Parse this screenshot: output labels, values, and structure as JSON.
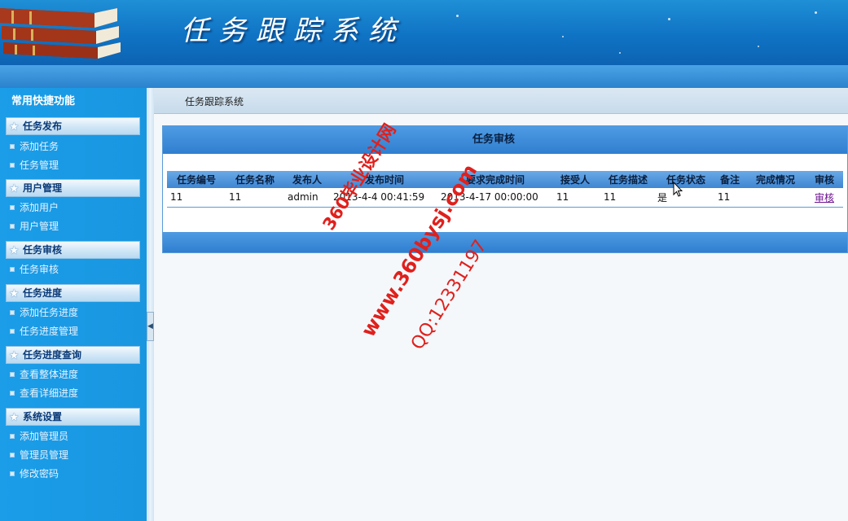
{
  "header": {
    "title": "任务跟踪系统"
  },
  "sidebar": {
    "title": "常用快捷功能",
    "groups": [
      {
        "label": "任务发布",
        "items": [
          {
            "label": "添加任务"
          },
          {
            "label": "任务管理"
          }
        ]
      },
      {
        "label": "用户管理",
        "items": [
          {
            "label": "添加用户"
          },
          {
            "label": "用户管理"
          }
        ]
      },
      {
        "label": "任务审核",
        "items": [
          {
            "label": "任务审核"
          }
        ]
      },
      {
        "label": "任务进度",
        "items": [
          {
            "label": "添加任务进度"
          },
          {
            "label": "任务进度管理"
          }
        ]
      },
      {
        "label": "任务进度查询",
        "items": [
          {
            "label": "查看整体进度"
          },
          {
            "label": "查看详细进度"
          }
        ]
      },
      {
        "label": "系统设置",
        "items": [
          {
            "label": "添加管理员"
          },
          {
            "label": "管理员管理"
          },
          {
            "label": "修改密码"
          }
        ]
      }
    ]
  },
  "breadcrumb": "任务跟踪系统",
  "panel": {
    "title": "任务审核",
    "columns": [
      "任务编号",
      "任务名称",
      "发布人",
      "发布时间",
      "要求完成时间",
      "接受人",
      "任务描述",
      "任务状态",
      "备注",
      "完成情况",
      "审核"
    ],
    "rows": [
      [
        "11",
        "11",
        "admin",
        "2013-4-4 00:41:59",
        "2013-4-17 00:00:00",
        "11",
        "11",
        "是",
        "11",
        "",
        "审核"
      ]
    ]
  },
  "watermark": {
    "line1": "360毕业设计网",
    "line2": "www.360bysj.com",
    "line3": "QQ:12331197"
  },
  "colors": {
    "header": "#0f73c4",
    "sidebar": "#1996e0",
    "panel_header": "#3f86d3",
    "link": "#6b0f8f",
    "watermark": "#e0201c"
  },
  "icons": {
    "logo": "books-icon",
    "group": "star-icon",
    "item": "square-bullet-icon",
    "splitter": "collapse-arrow-icon",
    "pointer": "mouse-cursor-icon"
  }
}
